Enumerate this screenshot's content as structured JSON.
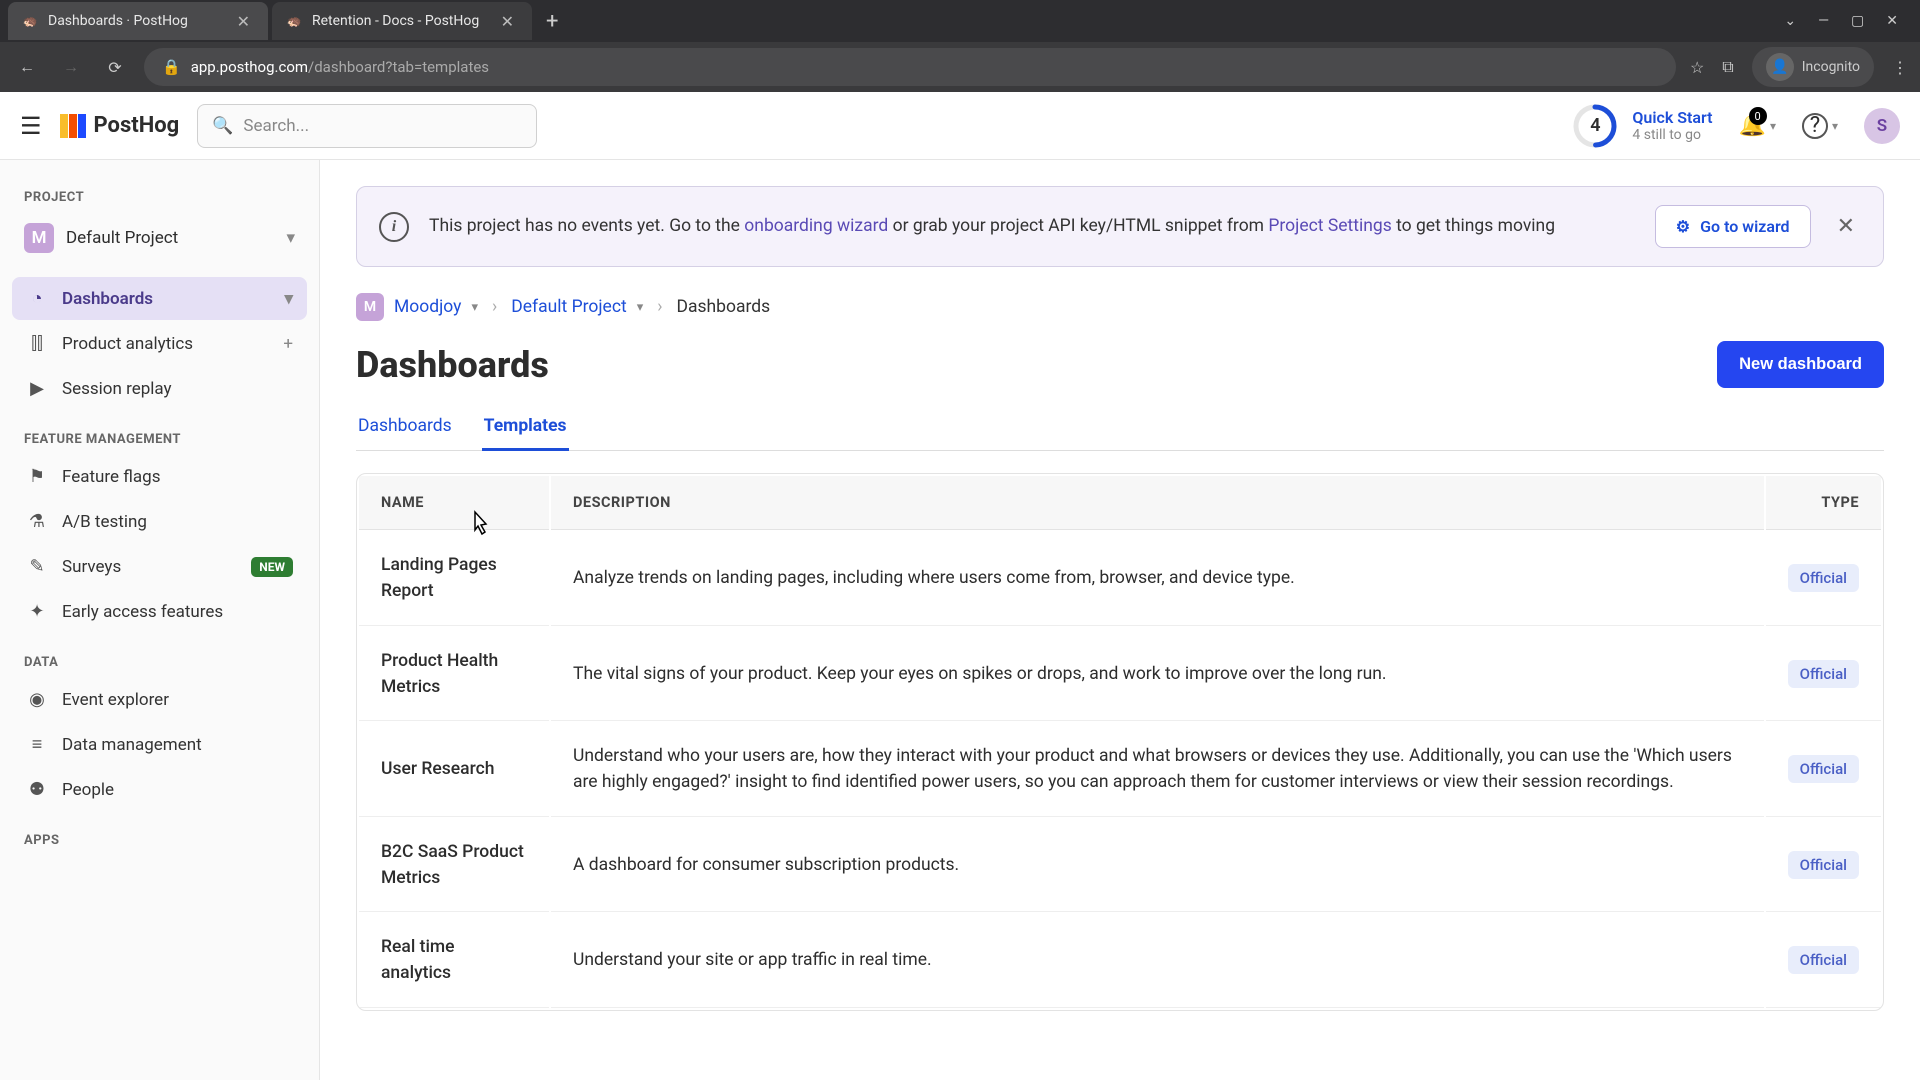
{
  "browser": {
    "tabs": [
      {
        "title": "Dashboards · PostHog",
        "active": true
      },
      {
        "title": "Retention - Docs - PostHog",
        "active": false
      }
    ],
    "url_host": "app.posthog.com",
    "url_path": "/dashboard?tab=templates",
    "incognito_label": "Incognito"
  },
  "header": {
    "logo_text": "PostHog",
    "search_placeholder": "Search...",
    "quick_start": {
      "progress": "4",
      "title": "Quick Start",
      "subtitle": "4 still to go"
    },
    "notifications_count": "0",
    "user_initial": "S"
  },
  "sidebar": {
    "section_project": "PROJECT",
    "project_avatar": "M",
    "project_name": "Default Project",
    "items_main": [
      {
        "icon": "◔",
        "label": "Dashboards",
        "active": true,
        "trailing": "chevron"
      },
      {
        "icon": "⫿⫿",
        "label": "Product analytics",
        "trailing": "plus"
      },
      {
        "icon": "▶",
        "label": "Session replay"
      }
    ],
    "section_feature": "FEATURE MANAGEMENT",
    "items_feature": [
      {
        "icon": "⚑",
        "label": "Feature flags"
      },
      {
        "icon": "⚗",
        "label": "A/B testing"
      },
      {
        "icon": "✎",
        "label": "Surveys",
        "badge": "NEW"
      },
      {
        "icon": "✦",
        "label": "Early access features"
      }
    ],
    "section_data": "DATA",
    "items_data": [
      {
        "icon": "◉",
        "label": "Event explorer"
      },
      {
        "icon": "≡",
        "label": "Data management"
      },
      {
        "icon": "⚉",
        "label": "People"
      }
    ],
    "section_apps": "APPS"
  },
  "banner": {
    "text_pre": "This project has no events yet. Go to the ",
    "link1": "onboarding wizard",
    "text_mid": " or grab your project API key/HTML snippet from ",
    "link2": "Project Settings",
    "text_post": " to get things moving",
    "button": "Go to wizard"
  },
  "breadcrumb": {
    "avatar": "M",
    "org": "Moodjoy",
    "project": "Default Project",
    "current": "Dashboards"
  },
  "page": {
    "title": "Dashboards",
    "new_button": "New dashboard",
    "tab1": "Dashboards",
    "tab2": "Templates"
  },
  "table": {
    "col_name": "NAME",
    "col_desc": "DESCRIPTION",
    "col_type": "TYPE",
    "rows": [
      {
        "name": "Landing Pages Report",
        "desc": "Analyze trends on landing pages, including where users come from, browser, and device type.",
        "type": "Official"
      },
      {
        "name": "Product Health Metrics",
        "desc": "The vital signs of your product. Keep your eyes on spikes or drops, and work to improve over the long run.",
        "type": "Official"
      },
      {
        "name": "User Research",
        "desc": "Understand who your users are, how they interact with your product and what browsers or devices they use. Additionally, you can use the 'Which users are highly engaged?' insight to find identified power users, so you can approach them for customer interviews or view their session recordings.",
        "type": "Official"
      },
      {
        "name": "B2C SaaS Product Metrics",
        "desc": "A dashboard for consumer subscription products.",
        "type": "Official"
      },
      {
        "name": "Real time analytics",
        "desc": "Understand your site or app traffic in real time.",
        "type": "Official"
      }
    ]
  }
}
